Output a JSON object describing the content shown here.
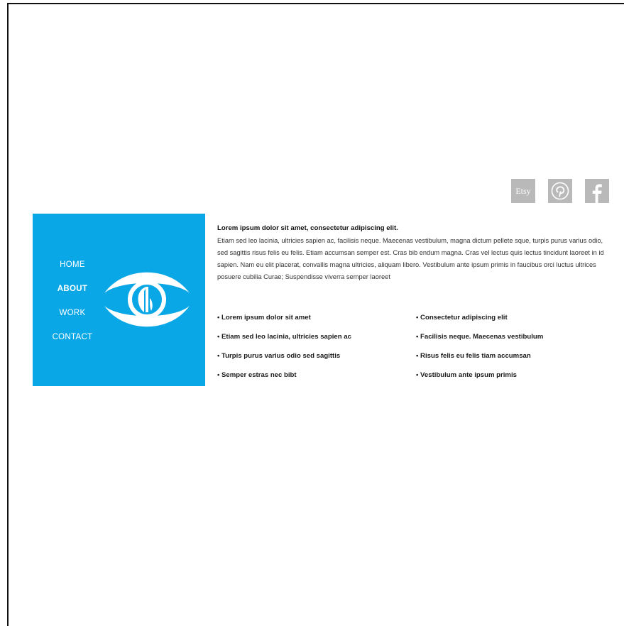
{
  "social": [
    {
      "name": "Etsy",
      "label": "Etsy",
      "icon": "etsy-icon"
    },
    {
      "name": "Pinterest",
      "label": "",
      "icon": "pinterest-icon"
    },
    {
      "name": "Facebook",
      "label": "",
      "icon": "facebook-icon"
    }
  ],
  "nav": {
    "items": [
      {
        "label": "HOME",
        "active": false
      },
      {
        "label": "ABOUT",
        "active": true
      },
      {
        "label": "WORK",
        "active": false
      },
      {
        "label": "CONTACT",
        "active": false
      }
    ]
  },
  "logo": {
    "icon": "eye-logo-icon"
  },
  "intro": {
    "title": "Lorem ipsum dolor sit amet, consectetur adipiscing elit.",
    "body": "Etiam sed leo lacinia, ultricies sapien ac, facilisis neque. Maecenas vestibulum, magna dictum pellete sque, turpis purus varius odio, sed sagittis risus felis eu felis. Etiam accumsan semper est. Cras bib endum magna. Cras vel lectus quis lectus tincidunt laoreet in id sapien. Nam eu elit placerat, convallis magna ultricies, aliquam libero. Vestibulum ante ipsum primis in faucibus orci luctus ultrices posuere cubilia Curae; Suspendisse viverra semper laoreet"
  },
  "bullets": {
    "left": [
      "• Lorem ipsum dolor sit amet",
      "• Etiam sed leo lacinia, ultricies sapien ac",
      "• Turpis purus varius odio sed sagittis",
      "• Semper estras nec bibt"
    ],
    "right": [
      "• Consectetur adipiscing elit",
      "• Facilisis neque. Maecenas vestibulum",
      "• Risus felis eu felis tiam accumsan",
      "• Vestibulum ante ipsum primis"
    ]
  },
  "colors": {
    "accent": "#0aa7e6",
    "social_bg": "#b9b9b9",
    "text": "#222222"
  }
}
